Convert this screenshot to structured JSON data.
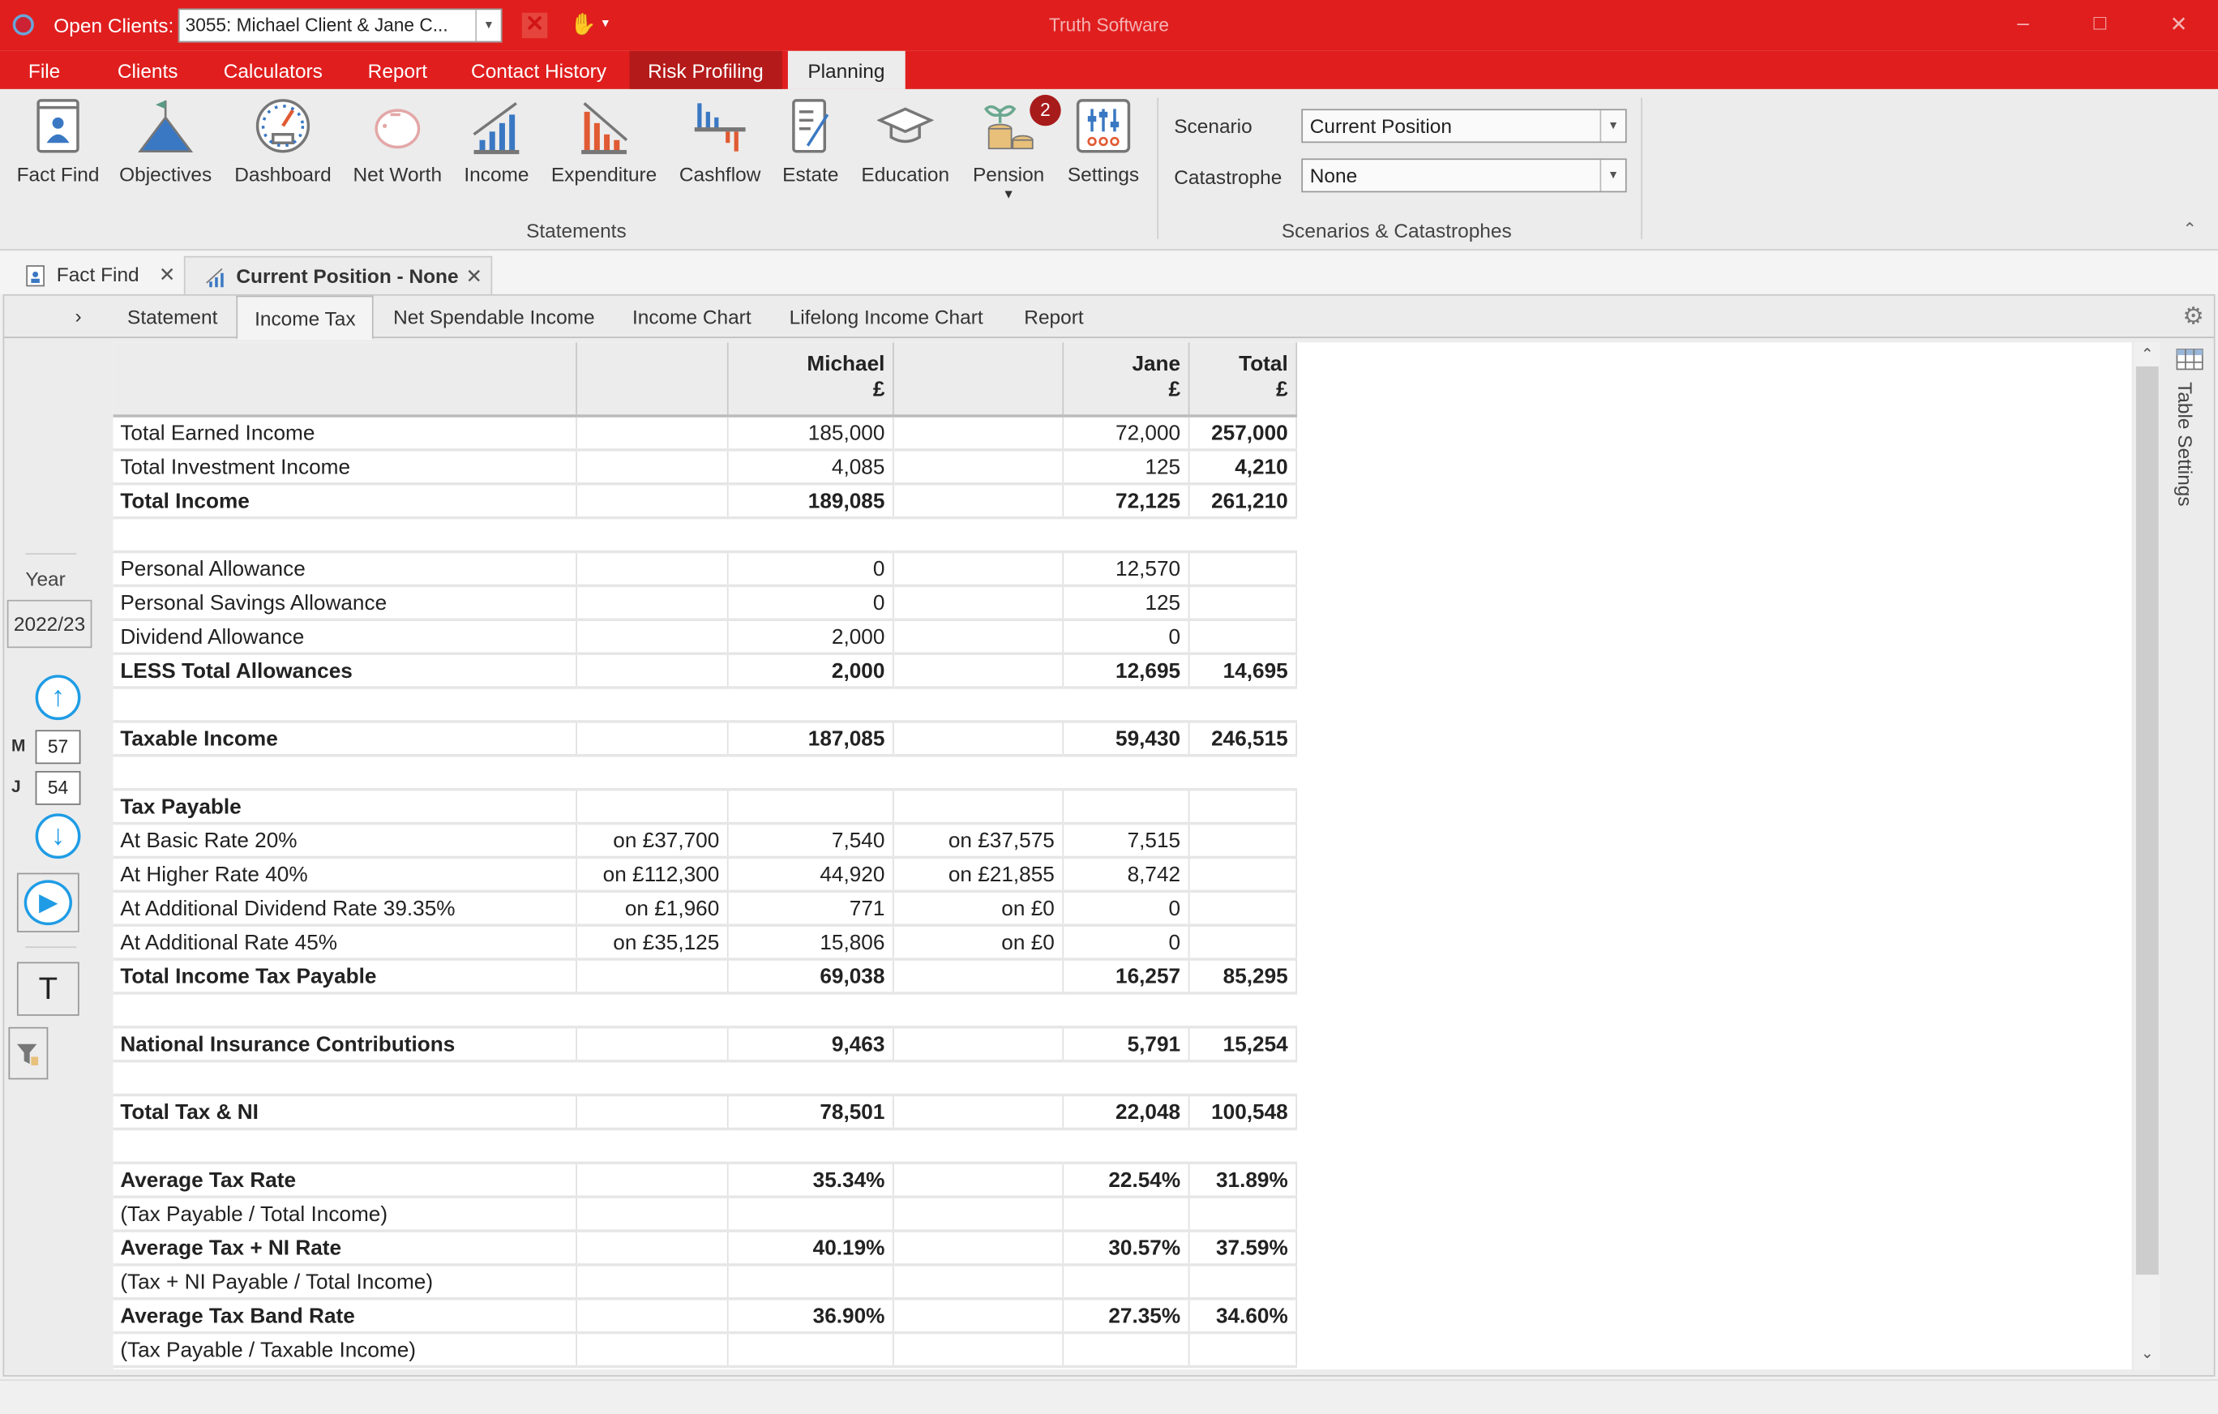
{
  "titlebar": {
    "open_clients_label": "Open Clients:",
    "open_clients_value": "3055: Michael Client & Jane C...",
    "app_title": "Truth Software",
    "minimize": "–",
    "restore": "□",
    "close": "✕"
  },
  "menu": {
    "items": [
      "File",
      "Clients",
      "Calculators",
      "Report",
      "Contact History",
      "Risk Profiling",
      "Planning"
    ],
    "active": "Planning"
  },
  "ribbon": {
    "statements_group_label": "Statements",
    "buttons": [
      {
        "label": "Fact Find",
        "icon": "fact-find-icon"
      },
      {
        "label": "Objectives",
        "icon": "mountain-flag-icon"
      },
      {
        "label": "Dashboard",
        "icon": "gauge-icon"
      },
      {
        "label": "Net Worth",
        "icon": "piggy-bank-icon"
      },
      {
        "label": "Income",
        "icon": "income-chart-icon"
      },
      {
        "label": "Expenditure",
        "icon": "expenditure-chart-icon"
      },
      {
        "label": "Cashflow",
        "icon": "cashflow-chart-icon"
      },
      {
        "label": "Estate",
        "icon": "estate-document-icon"
      },
      {
        "label": "Education",
        "icon": "graduation-cap-icon"
      },
      {
        "label": "Pension",
        "icon": "pension-coins-icon"
      },
      {
        "label": "Settings",
        "icon": "sliders-icon"
      }
    ],
    "pension_badge": "2",
    "scenario_label": "Scenario",
    "scenario_value": "Current Position",
    "catastrophe_label": "Catastrophe",
    "catastrophe_value": "None",
    "scenarios_group_label": "Scenarios & Catastrophes"
  },
  "doc_tabs": [
    {
      "label": "Fact Find",
      "close": "✕"
    },
    {
      "label": "Current Position - None",
      "close": "✕"
    }
  ],
  "sub_tabs": {
    "items": [
      "Statement",
      "Income Tax",
      "Net Spendable Income",
      "Income Chart",
      "Lifelong Income Chart",
      "Report"
    ],
    "active": "Income Tax",
    "expander": "›"
  },
  "left_panel": {
    "year_label": "Year",
    "year_value": "2022/23",
    "m_label": "M",
    "m_age": "57",
    "j_label": "J",
    "j_age": "54",
    "text_button": "T"
  },
  "table_settings_label": "Table Settings",
  "table": {
    "headers": [
      {
        "line1": "",
        "line2": ""
      },
      {
        "line1": "",
        "line2": ""
      },
      {
        "line1": "Michael",
        "line2": "£"
      },
      {
        "line1": "",
        "line2": ""
      },
      {
        "line1": "Jane",
        "line2": "£"
      },
      {
        "line1": "Total",
        "line2": "£"
      }
    ],
    "rows": [
      {
        "type": "normal",
        "cells": [
          "Total Earned Income",
          "",
          "185,000",
          "",
          "72,000",
          "257,000"
        ],
        "bold_total": true
      },
      {
        "type": "normal",
        "cells": [
          "Total Investment Income",
          "",
          "4,085",
          "",
          "125",
          "4,210"
        ],
        "bold_total": true
      },
      {
        "type": "bold",
        "cells": [
          "Total Income",
          "",
          "189,085",
          "",
          "72,125",
          "261,210"
        ]
      },
      {
        "type": "blank",
        "cells": [
          "",
          "",
          "",
          "",
          "",
          ""
        ]
      },
      {
        "type": "normal",
        "cells": [
          "Personal Allowance",
          "",
          "0",
          "",
          "12,570",
          ""
        ]
      },
      {
        "type": "normal",
        "cells": [
          "Personal Savings Allowance",
          "",
          "0",
          "",
          "125",
          ""
        ]
      },
      {
        "type": "normal",
        "cells": [
          "Dividend Allowance",
          "",
          "2,000",
          "",
          "0",
          ""
        ]
      },
      {
        "type": "bold",
        "cells": [
          "LESS Total Allowances",
          "",
          "2,000",
          "",
          "12,695",
          "14,695"
        ]
      },
      {
        "type": "blank",
        "cells": [
          "",
          "",
          "",
          "",
          "",
          ""
        ]
      },
      {
        "type": "bold",
        "cells": [
          "Taxable Income",
          "",
          "187,085",
          "",
          "59,430",
          "246,515"
        ]
      },
      {
        "type": "blank",
        "cells": [
          "",
          "",
          "",
          "",
          "",
          ""
        ]
      },
      {
        "type": "bold",
        "cells": [
          "Tax Payable",
          "",
          "",
          "",
          "",
          ""
        ]
      },
      {
        "type": "normal",
        "cells": [
          "At Basic Rate 20%",
          "on £37,700",
          "7,540",
          "on £37,575",
          "7,515",
          ""
        ]
      },
      {
        "type": "normal",
        "cells": [
          "At Higher Rate 40%",
          "on £112,300",
          "44,920",
          "on £21,855",
          "8,742",
          ""
        ]
      },
      {
        "type": "normal",
        "cells": [
          "At Additional Dividend Rate 39.35%",
          "on £1,960",
          "771",
          "on £0",
          "0",
          ""
        ]
      },
      {
        "type": "normal",
        "cells": [
          "At Additional Rate 45%",
          "on £35,125",
          "15,806",
          "on £0",
          "0",
          ""
        ]
      },
      {
        "type": "bold",
        "cells": [
          "Total Income Tax Payable",
          "",
          "69,038",
          "",
          "16,257",
          "85,295"
        ]
      },
      {
        "type": "blank",
        "cells": [
          "",
          "",
          "",
          "",
          "",
          ""
        ]
      },
      {
        "type": "bold",
        "cells": [
          "National Insurance Contributions",
          "",
          "9,463",
          "",
          "5,791",
          "15,254"
        ]
      },
      {
        "type": "blank",
        "cells": [
          "",
          "",
          "",
          "",
          "",
          ""
        ]
      },
      {
        "type": "bold",
        "cells": [
          "Total Tax & NI",
          "",
          "78,501",
          "",
          "22,048",
          "100,548"
        ]
      },
      {
        "type": "blank",
        "cells": [
          "",
          "",
          "",
          "",
          "",
          ""
        ]
      },
      {
        "type": "bold",
        "cells": [
          "Average Tax Rate",
          "",
          "35.34%",
          "",
          "22.54%",
          "31.89%"
        ]
      },
      {
        "type": "normal",
        "cells": [
          "(Tax Payable / Total Income)",
          "",
          "",
          "",
          "",
          ""
        ]
      },
      {
        "type": "bold",
        "cells": [
          "Average Tax + NI Rate",
          "",
          "40.19%",
          "",
          "30.57%",
          "37.59%"
        ]
      },
      {
        "type": "normal",
        "cells": [
          "(Tax + NI Payable / Total Income)",
          "",
          "",
          "",
          "",
          ""
        ]
      },
      {
        "type": "bold",
        "cells": [
          "Average Tax Band Rate",
          "",
          "36.90%",
          "",
          "27.35%",
          "34.60%"
        ]
      },
      {
        "type": "normal",
        "cells": [
          "(Tax Payable / Taxable Income)",
          "",
          "",
          "",
          "",
          ""
        ]
      }
    ]
  },
  "colors": {
    "brand_red": "#e01e1e",
    "risk_tab": "#b51a1a",
    "badge": "#a81b1b",
    "nav_blue": "#1f9ce5"
  }
}
